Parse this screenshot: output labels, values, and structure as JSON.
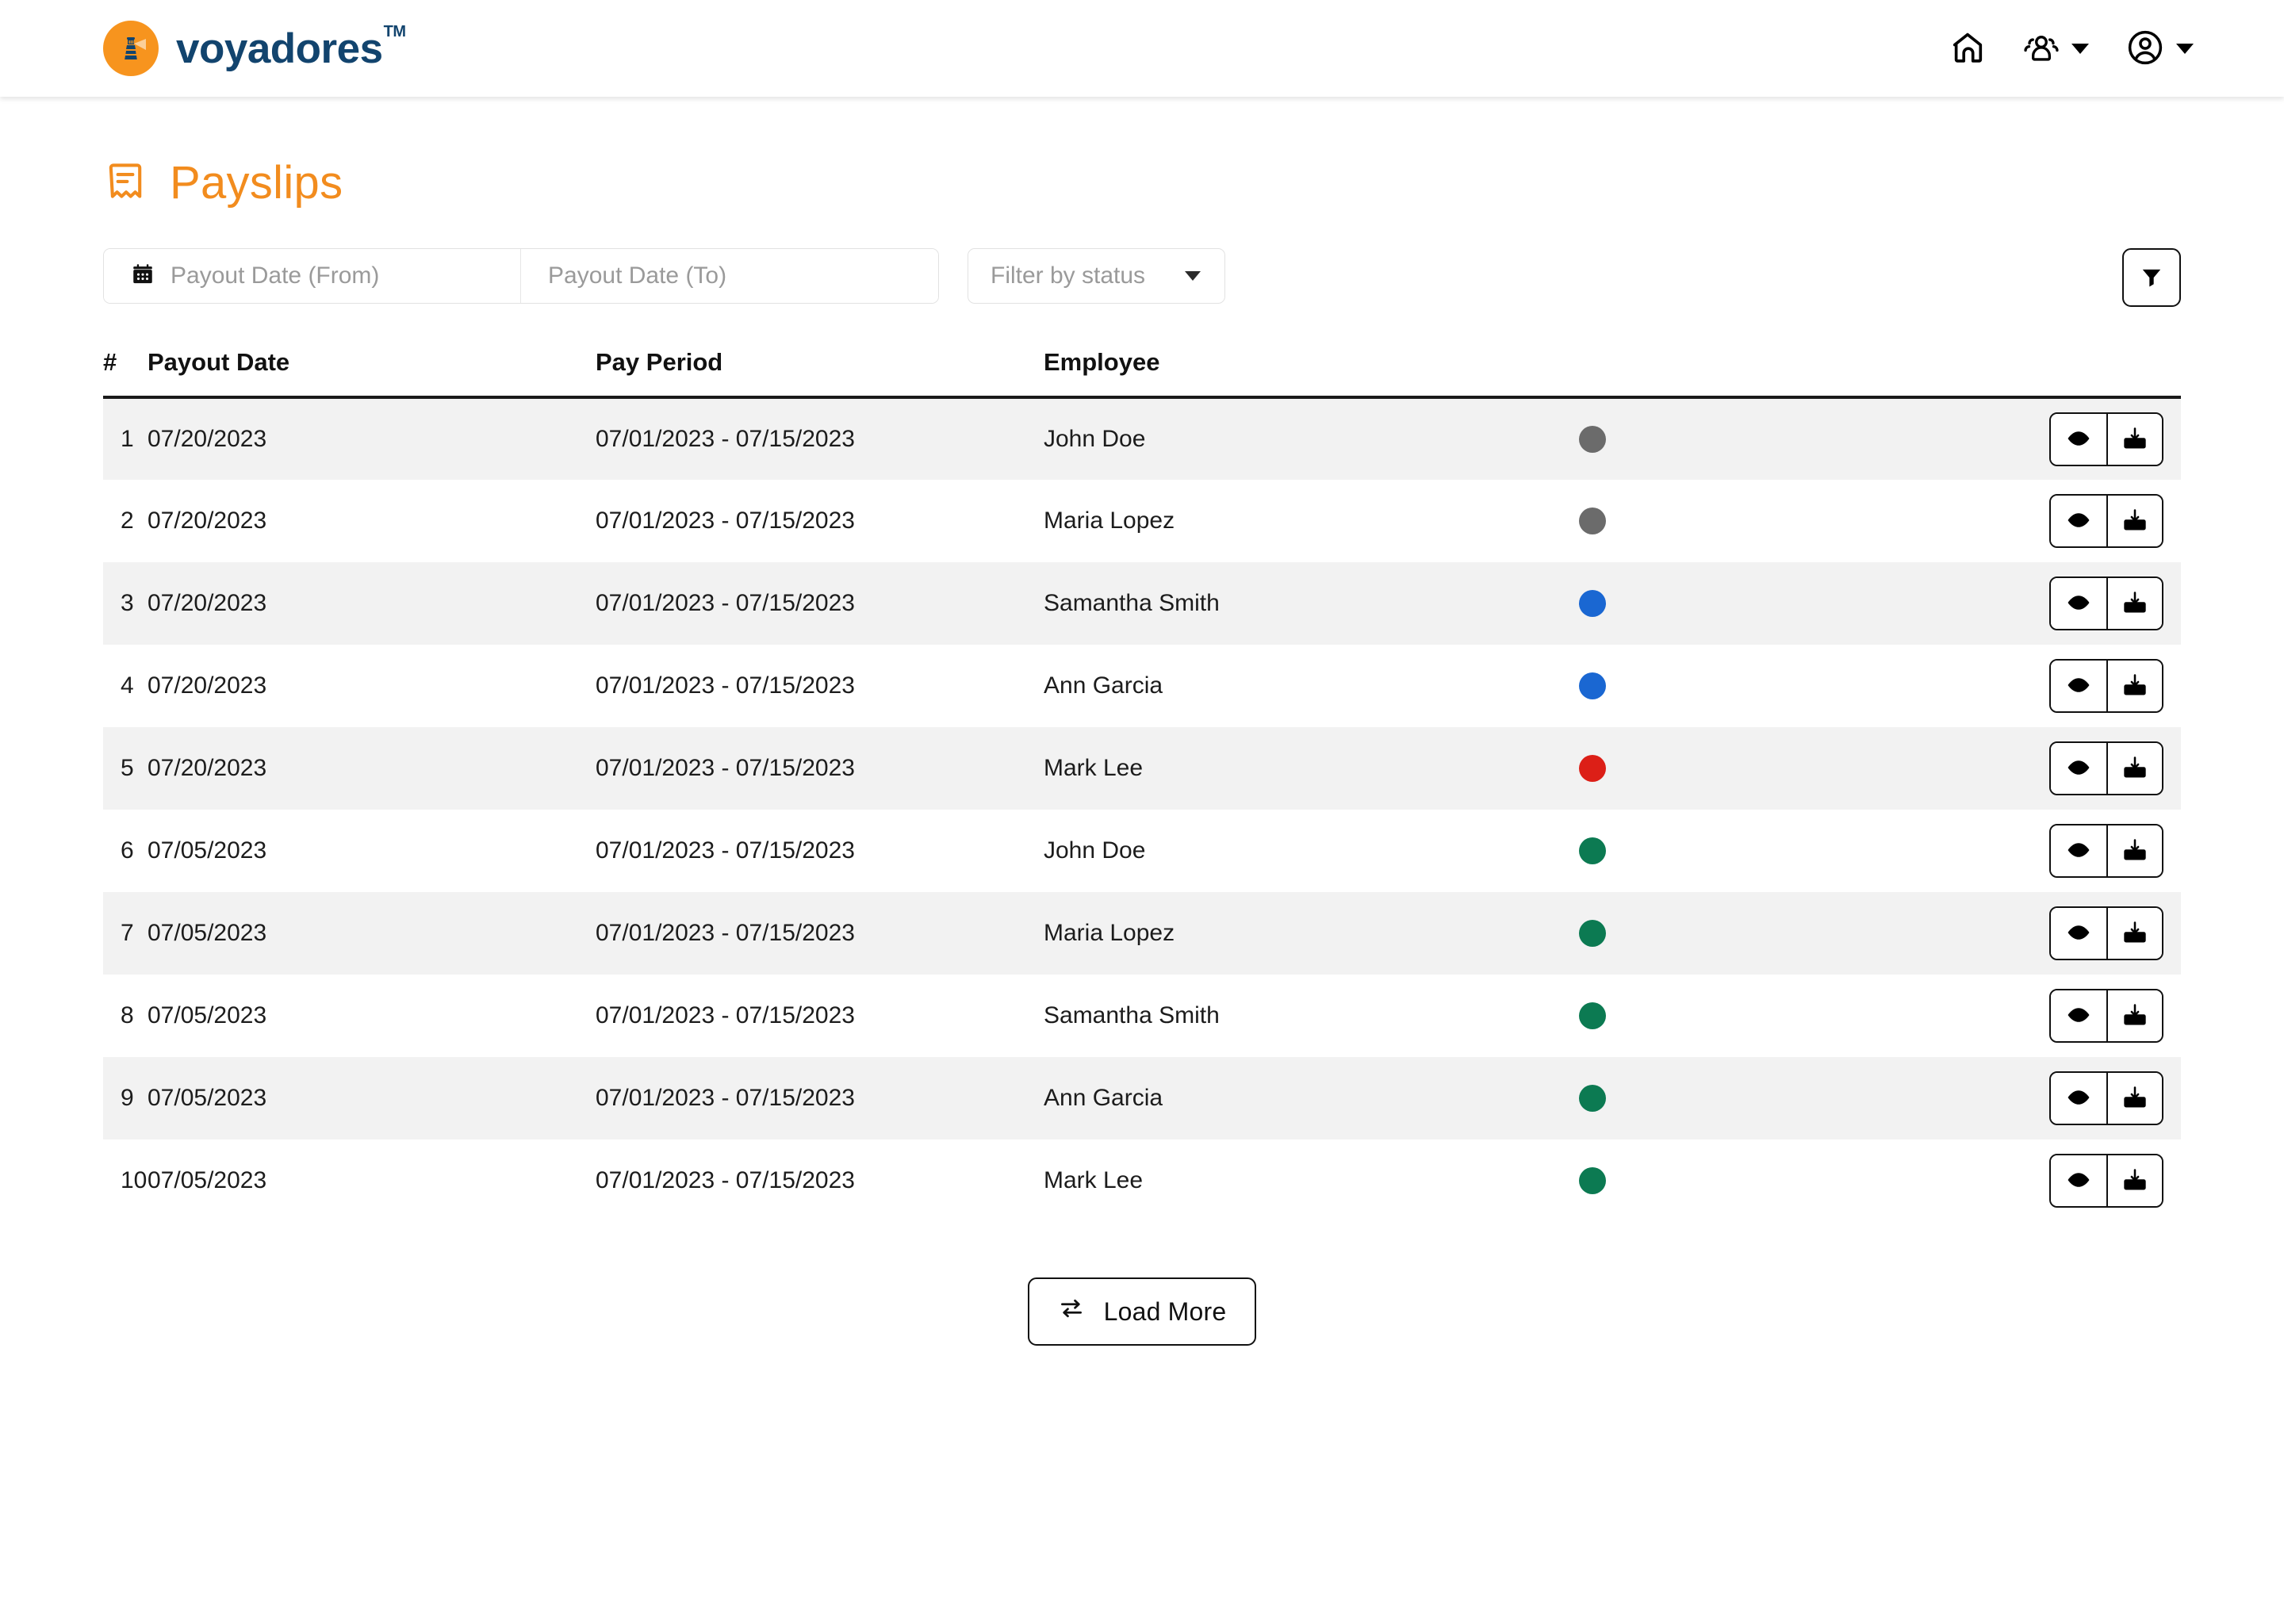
{
  "brand": {
    "name": "voyadores",
    "tm": "TM",
    "logo_icon": "lighthouse-icon",
    "accent_color": "#f7941e",
    "navy_color": "#12446e"
  },
  "header": {
    "home_icon": "home-icon",
    "teams_icon": "users-group-icon",
    "account_icon": "user-circle-icon",
    "caret_icon": "chevron-down-icon"
  },
  "page": {
    "title": "Payslips",
    "title_icon": "receipt-icon",
    "title_color": "#f28c1e"
  },
  "filters": {
    "calendar_icon": "calendar-icon",
    "date_from_placeholder": "Payout Date (From)",
    "date_from_value": "",
    "date_to_placeholder": "Payout Date (To)",
    "date_to_value": "",
    "status_label": "Filter by status",
    "status_caret_icon": "chevron-down-icon",
    "funnel_icon": "filter-funnel-icon"
  },
  "table": {
    "columns": [
      "#",
      "Payout Date",
      "Pay Period",
      "Employee"
    ],
    "view_icon": "eye-icon",
    "download_icon": "download-icon",
    "status_colors": {
      "grey": "#6b6b6b",
      "blue": "#1a67d2",
      "red": "#dc1f17",
      "green": "#0c7a52"
    },
    "rows": [
      {
        "num": "1",
        "payout_date": "07/20/2023",
        "pay_period": "07/01/2023 - 07/15/2023",
        "employee": "John Doe",
        "status_color": "#6b6b6b"
      },
      {
        "num": "2",
        "payout_date": "07/20/2023",
        "pay_period": "07/01/2023 - 07/15/2023",
        "employee": "Maria Lopez",
        "status_color": "#6b6b6b"
      },
      {
        "num": "3",
        "payout_date": "07/20/2023",
        "pay_period": "07/01/2023 - 07/15/2023",
        "employee": "Samantha Smith",
        "status_color": "#1a67d2"
      },
      {
        "num": "4",
        "payout_date": "07/20/2023",
        "pay_period": "07/01/2023 - 07/15/2023",
        "employee": "Ann Garcia",
        "status_color": "#1a67d2"
      },
      {
        "num": "5",
        "payout_date": "07/20/2023",
        "pay_period": "07/01/2023 - 07/15/2023",
        "employee": "Mark Lee",
        "status_color": "#dc1f17"
      },
      {
        "num": "6",
        "payout_date": "07/05/2023",
        "pay_period": "07/01/2023 - 07/15/2023",
        "employee": "John Doe",
        "status_color": "#0c7a52"
      },
      {
        "num": "7",
        "payout_date": "07/05/2023",
        "pay_period": "07/01/2023 - 07/15/2023",
        "employee": "Maria Lopez",
        "status_color": "#0c7a52"
      },
      {
        "num": "8",
        "payout_date": "07/05/2023",
        "pay_period": "07/01/2023 - 07/15/2023",
        "employee": "Samantha Smith",
        "status_color": "#0c7a52"
      },
      {
        "num": "9",
        "payout_date": "07/05/2023",
        "pay_period": "07/01/2023 - 07/15/2023",
        "employee": "Ann Garcia",
        "status_color": "#0c7a52"
      },
      {
        "num": "10",
        "payout_date": "07/05/2023",
        "pay_period": "07/01/2023 - 07/15/2023",
        "employee": "Mark Lee",
        "status_color": "#0c7a52"
      }
    ]
  },
  "load_more": {
    "label": "Load More",
    "icon": "repeat-arrows-icon"
  }
}
